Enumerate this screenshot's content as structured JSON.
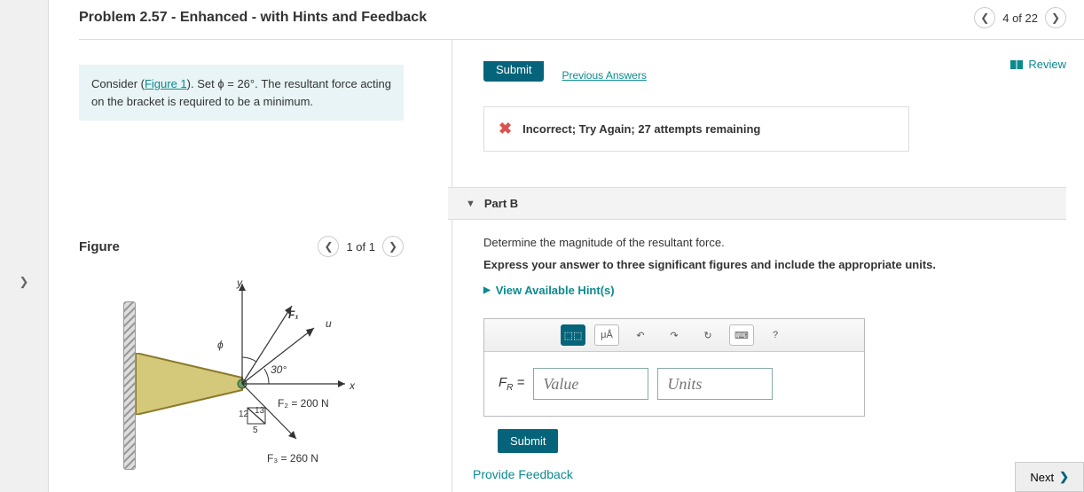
{
  "header": {
    "title": "Problem 2.57 - Enhanced - with Hints and Feedback",
    "page_label": "4 of 22"
  },
  "review_label": "Review",
  "prompt": {
    "pre": "Consider (",
    "figlink": "Figure 1",
    "post": "). Set ϕ = 26°. The resultant force acting on the bracket is required to be a minimum."
  },
  "figure": {
    "title": "Figure",
    "page_label": "1 of 1",
    "labels": {
      "y": "y",
      "x": "x",
      "u": "u",
      "phi": "ϕ",
      "F1": "F₁",
      "angle30": "30°",
      "F2eq": "F₂ = 200 N",
      "F3eq": "F₃ = 260 N",
      "n12": "12",
      "n13": "13",
      "n5": "5"
    }
  },
  "top_actions": {
    "submit": "Submit",
    "prev_answers": "Previous Answers"
  },
  "alert": {
    "message": "Incorrect; Try Again; 27 attempts remaining"
  },
  "partB": {
    "header": "Part B",
    "question": "Determine the magnitude of the resultant force.",
    "instruction": "Express your answer to three significant figures and include the appropriate units.",
    "hints_label": "View Available Hint(s)",
    "var_label_html": "F_R =",
    "value_placeholder": "Value",
    "units_placeholder": "Units",
    "submit": "Submit",
    "toolbar": {
      "templates": "⬚⬚",
      "units_btn": "μÅ",
      "undo": "↶",
      "redo": "↷",
      "reset": "↻",
      "keyboard": "⌨",
      "help": "?"
    }
  },
  "feedback_link": "Provide Feedback",
  "next_label": "Next"
}
